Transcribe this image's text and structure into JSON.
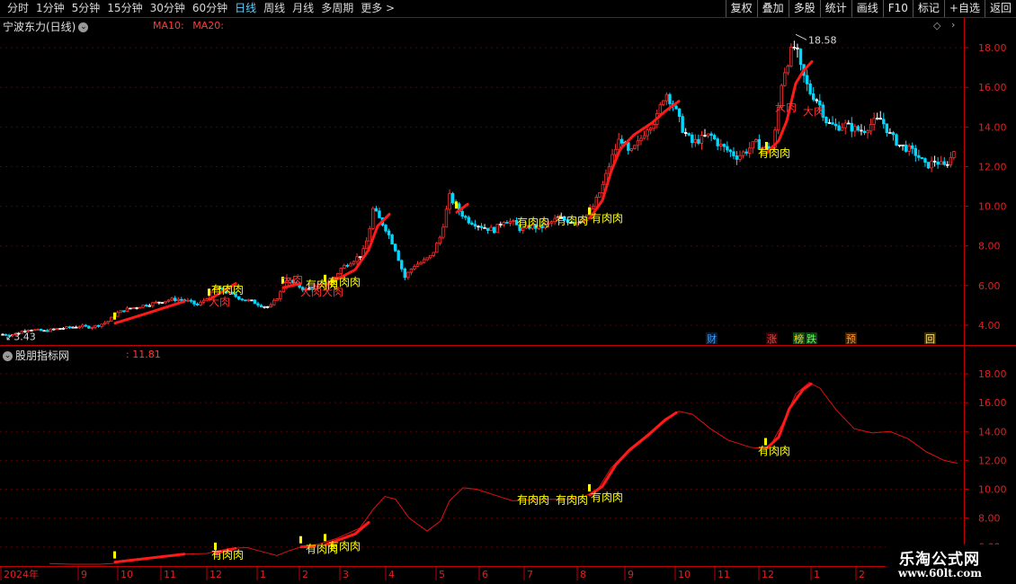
{
  "toolbar": {
    "periods": [
      "分时",
      "1分钟",
      "5分钟",
      "15分钟",
      "30分钟",
      "60分钟",
      "日线",
      "周线",
      "月线",
      "多周期",
      "更多 >"
    ],
    "active_period": "日线",
    "tools": [
      "复权",
      "叠加",
      "多股",
      "统计",
      "画线",
      "F10",
      "标记",
      "+自选",
      "返回"
    ]
  },
  "upper": {
    "title": "宁波东力(日线)",
    "ma10_label": "MA10:",
    "ma20_label": "MA20:",
    "high_label": "18.58",
    "low_label": "3.43",
    "event_markers": [
      {
        "text": "财",
        "color": "#3aa0ff",
        "bg": "#0b1a33"
      },
      {
        "text": "涨",
        "color": "#ff4040",
        "bg": "#2a0808"
      },
      {
        "text": "榜",
        "color": "#ffd200",
        "bg": "#1a4a1a"
      },
      {
        "text": "跌",
        "color": "#60ff60",
        "bg": "#1a3a1a"
      },
      {
        "text": "预",
        "color": "#ff9a30",
        "bg": "#3a2208"
      },
      {
        "text": "回",
        "color": "#ffe070",
        "bg": "#3a3010"
      }
    ]
  },
  "lower": {
    "title": "股朋指标网",
    "value": ": 11.81"
  },
  "signal_labels": {
    "you": "有肉肉",
    "da": "大肉"
  },
  "watermark": {
    "line1": "乐淘公式网",
    "line2": "www.60lt.com"
  },
  "colors": {
    "up": "#ff3030",
    "down": "#00d8ff",
    "flat": "#ffffff",
    "signal": "#ffff00",
    "axis": "#c00000",
    "grid": "#5a0000"
  },
  "chart_data": [
    {
      "type": "candlestick",
      "name": "宁波东力(日线)",
      "ylim": [
        3.0,
        19.5
      ],
      "yticks": [
        4.0,
        6.0,
        8.0,
        10.0,
        12.0,
        14.0,
        16.0,
        18.0
      ],
      "x_tick_labels": [
        "2024年",
        "9",
        "10",
        "11",
        "12",
        "1",
        "2",
        "3",
        "4",
        "5",
        "6",
        "7",
        "8",
        "9",
        "10",
        "11",
        "12",
        "1",
        "2"
      ],
      "close_path": [
        [
          0,
          3.55
        ],
        [
          10,
          3.5
        ],
        [
          20,
          3.6
        ],
        [
          30,
          3.8
        ],
        [
          40,
          3.75
        ],
        [
          50,
          3.7
        ],
        [
          60,
          3.8
        ],
        [
          70,
          3.85
        ],
        [
          80,
          3.9
        ],
        [
          90,
          3.95
        ],
        [
          100,
          3.9
        ],
        [
          110,
          4.0
        ],
        [
          120,
          4.2
        ],
        [
          130,
          4.6
        ],
        [
          140,
          4.8
        ],
        [
          150,
          4.9
        ],
        [
          160,
          5.0
        ],
        [
          170,
          5.1
        ],
        [
          180,
          5.2
        ],
        [
          190,
          5.3
        ],
        [
          200,
          5.3
        ],
        [
          210,
          5.2
        ],
        [
          220,
          5.0
        ],
        [
          230,
          5.4
        ],
        [
          240,
          5.9
        ],
        [
          250,
          5.7
        ],
        [
          260,
          5.5
        ],
        [
          270,
          5.3
        ],
        [
          280,
          5.2
        ],
        [
          290,
          5.0
        ],
        [
          300,
          4.9
        ],
        [
          310,
          5.5
        ],
        [
          320,
          6.3
        ],
        [
          330,
          6.0
        ],
        [
          340,
          5.8
        ],
        [
          350,
          5.9
        ],
        [
          360,
          6.1
        ],
        [
          370,
          6.3
        ],
        [
          380,
          6.9
        ],
        [
          390,
          7.2
        ],
        [
          400,
          7.5
        ],
        [
          405,
          7.8
        ],
        [
          410,
          8.6
        ],
        [
          415,
          9.9
        ],
        [
          420,
          9.5
        ],
        [
          430,
          8.8
        ],
        [
          440,
          7.8
        ],
        [
          450,
          6.4
        ],
        [
          460,
          7.0
        ],
        [
          470,
          7.2
        ],
        [
          480,
          7.5
        ],
        [
          490,
          8.5
        ],
        [
          500,
          10.5
        ],
        [
          510,
          9.8
        ],
        [
          520,
          9.3
        ],
        [
          530,
          9.1
        ],
        [
          540,
          8.9
        ],
        [
          550,
          8.8
        ],
        [
          560,
          9.3
        ],
        [
          570,
          9.2
        ],
        [
          580,
          8.8
        ],
        [
          590,
          9.0
        ],
        [
          600,
          8.9
        ],
        [
          610,
          9.1
        ],
        [
          620,
          9.4
        ],
        [
          630,
          9.3
        ],
        [
          640,
          9.2
        ],
        [
          650,
          9.4
        ],
        [
          660,
          10.0
        ],
        [
          670,
          11.0
        ],
        [
          680,
          12.4
        ],
        [
          690,
          13.5
        ],
        [
          700,
          12.6
        ],
        [
          710,
          13.2
        ],
        [
          720,
          14.0
        ],
        [
          730,
          14.4
        ],
        [
          740,
          15.8
        ],
        [
          750,
          15.0
        ],
        [
          760,
          13.8
        ],
        [
          770,
          13.2
        ],
        [
          780,
          13.4
        ],
        [
          790,
          13.6
        ],
        [
          800,
          13.1
        ],
        [
          810,
          12.8
        ],
        [
          820,
          12.5
        ],
        [
          830,
          12.8
        ],
        [
          840,
          13.2
        ],
        [
          850,
          12.9
        ],
        [
          860,
          13.0
        ],
        [
          870,
          16.5
        ],
        [
          880,
          17.8
        ],
        [
          885,
          18.1
        ],
        [
          890,
          17.0
        ],
        [
          900,
          15.8
        ],
        [
          910,
          15.3
        ],
        [
          920,
          14.2
        ],
        [
          930,
          14.0
        ],
        [
          940,
          14.1
        ],
        [
          950,
          13.9
        ],
        [
          960,
          13.8
        ],
        [
          970,
          14.2
        ],
        [
          980,
          14.4
        ],
        [
          990,
          13.6
        ],
        [
          1000,
          13.1
        ],
        [
          1010,
          12.9
        ],
        [
          1020,
          12.6
        ],
        [
          1030,
          12.0
        ],
        [
          1040,
          12.3
        ],
        [
          1050,
          12.0
        ],
        [
          1060,
          12.6
        ],
        [
          1065,
          13.8
        ]
      ],
      "signal_segments": [
        [
          [
            128,
            4.1
          ],
          [
            160,
            4.55
          ],
          [
            205,
            5.2
          ]
        ],
        [
          [
            233,
            5.3
          ],
          [
            262,
            6.1
          ]
        ],
        [
          [
            315,
            5.9
          ],
          [
            334,
            6.1
          ]
        ],
        [
          [
            362,
            6.0
          ],
          [
            395,
            6.8
          ],
          [
            410,
            7.8
          ],
          [
            420,
            9.0
          ],
          [
            433,
            9.6
          ]
        ],
        [
          [
            508,
            9.7
          ],
          [
            520,
            10.1
          ]
        ],
        [
          [
            656,
            9.4
          ],
          [
            670,
            10.3
          ],
          [
            680,
            11.8
          ],
          [
            690,
            12.9
          ],
          [
            705,
            13.6
          ],
          [
            725,
            14.2
          ],
          [
            740,
            14.8
          ],
          [
            755,
            15.3
          ]
        ],
        [
          [
            853,
            12.7
          ],
          [
            866,
            13.3
          ],
          [
            875,
            14.3
          ],
          [
            885,
            16.2
          ],
          [
            893,
            16.8
          ],
          [
            903,
            17.3
          ]
        ]
      ],
      "annotations": [
        {
          "text": "有肉肉",
          "x": 235,
          "y": 5.6,
          "color": "#ffff00"
        },
        {
          "text": "大肉",
          "x": 232,
          "y": 5.0,
          "color": "#ff3030"
        },
        {
          "text": "大肉",
          "x": 313,
          "y": 6.1,
          "color": "#ff3030"
        },
        {
          "text": "有肉肉",
          "x": 340,
          "y": 5.85,
          "color": "#ffff00"
        },
        {
          "text": "大肉大肉",
          "x": 334,
          "y": 5.5,
          "color": "#ff3030"
        },
        {
          "text": "有肉肉",
          "x": 365,
          "y": 6.0,
          "color": "#ffff00"
        },
        {
          "text": "有肉肉",
          "x": 575,
          "y": 9.0,
          "color": "#ffff00"
        },
        {
          "text": "有肉肉",
          "x": 618,
          "y": 9.1,
          "color": "#ffff00"
        },
        {
          "text": "有肉肉",
          "x": 657,
          "y": 9.2,
          "color": "#ffff00"
        },
        {
          "text": "有肉肉",
          "x": 843,
          "y": 12.5,
          "color": "#ffff00"
        },
        {
          "text": "大肉",
          "x": 862,
          "y": 14.8,
          "color": "#ff3030"
        },
        {
          "text": "大肉",
          "x": 893,
          "y": 14.6,
          "color": "#ff3030"
        }
      ]
    },
    {
      "type": "line",
      "name": "股朋指标网",
      "ylim": [
        4.8,
        19.0
      ],
      "yticks": [
        6.0,
        8.0,
        10.0,
        12.0,
        14.0,
        16.0,
        18.0
      ],
      "last_value": 11.81,
      "series": [
        [
          55,
          4.85
        ],
        [
          80,
          4.8
        ],
        [
          110,
          4.8
        ],
        [
          125,
          4.85
        ],
        [
          150,
          5.1
        ],
        [
          180,
          5.3
        ],
        [
          205,
          5.5
        ],
        [
          230,
          5.55
        ],
        [
          255,
          5.9
        ],
        [
          275,
          5.95
        ],
        [
          290,
          5.7
        ],
        [
          308,
          5.4
        ],
        [
          320,
          5.7
        ],
        [
          335,
          6.0
        ],
        [
          355,
          6.2
        ],
        [
          375,
          6.6
        ],
        [
          400,
          7.3
        ],
        [
          415,
          8.6
        ],
        [
          428,
          9.5
        ],
        [
          440,
          9.3
        ],
        [
          455,
          8.0
        ],
        [
          475,
          7.1
        ],
        [
          490,
          7.8
        ],
        [
          500,
          9.2
        ],
        [
          515,
          10.1
        ],
        [
          530,
          10.0
        ],
        [
          550,
          9.6
        ],
        [
          570,
          9.2
        ],
        [
          600,
          9.3
        ],
        [
          630,
          9.3
        ],
        [
          650,
          9.5
        ],
        [
          665,
          10.0
        ],
        [
          680,
          11.5
        ],
        [
          700,
          12.8
        ],
        [
          720,
          13.8
        ],
        [
          740,
          14.9
        ],
        [
          755,
          15.4
        ],
        [
          770,
          15.2
        ],
        [
          790,
          14.2
        ],
        [
          810,
          13.4
        ],
        [
          835,
          12.9
        ],
        [
          855,
          12.8
        ],
        [
          870,
          14.5
        ],
        [
          885,
          16.6
        ],
        [
          900,
          17.4
        ],
        [
          912,
          17.0
        ],
        [
          930,
          15.5
        ],
        [
          950,
          14.2
        ],
        [
          970,
          13.9
        ],
        [
          990,
          14.0
        ],
        [
          1010,
          13.5
        ],
        [
          1030,
          12.6
        ],
        [
          1050,
          12.0
        ],
        [
          1065,
          11.8
        ]
      ],
      "signal_segments": [
        [
          [
            128,
            4.95
          ],
          [
            170,
            5.25
          ],
          [
            205,
            5.5
          ]
        ],
        [
          [
            240,
            5.55
          ],
          [
            262,
            5.9
          ]
        ],
        [
          [
            335,
            6.0
          ],
          [
            350,
            6.05
          ]
        ],
        [
          [
            362,
            6.15
          ],
          [
            395,
            6.9
          ],
          [
            410,
            7.7
          ]
        ],
        [
          [
            656,
            9.6
          ],
          [
            670,
            10.2
          ],
          [
            685,
            11.7
          ],
          [
            700,
            12.7
          ],
          [
            720,
            13.7
          ],
          [
            740,
            14.8
          ],
          [
            752,
            15.3
          ]
        ],
        [
          [
            852,
            12.8
          ],
          [
            866,
            13.6
          ],
          [
            878,
            15.6
          ],
          [
            893,
            16.9
          ],
          [
            902,
            17.3
          ]
        ]
      ],
      "annotations": [
        {
          "text": "有肉肉",
          "x": 235,
          "y": 5.2,
          "color": "#ffff00"
        },
        {
          "text": "有肉肉",
          "x": 340,
          "y": 5.6,
          "color": "#ffff00"
        },
        {
          "text": "有肉肉",
          "x": 365,
          "y": 5.8,
          "color": "#ffff00"
        },
        {
          "text": "有肉肉",
          "x": 575,
          "y": 9.0,
          "color": "#ffff00"
        },
        {
          "text": "有肉肉",
          "x": 618,
          "y": 9.0,
          "color": "#ffff00"
        },
        {
          "text": "有肉肉",
          "x": 657,
          "y": 9.2,
          "color": "#ffff00"
        },
        {
          "text": "有肉肉",
          "x": 843,
          "y": 12.4,
          "color": "#ffff00"
        }
      ]
    }
  ]
}
